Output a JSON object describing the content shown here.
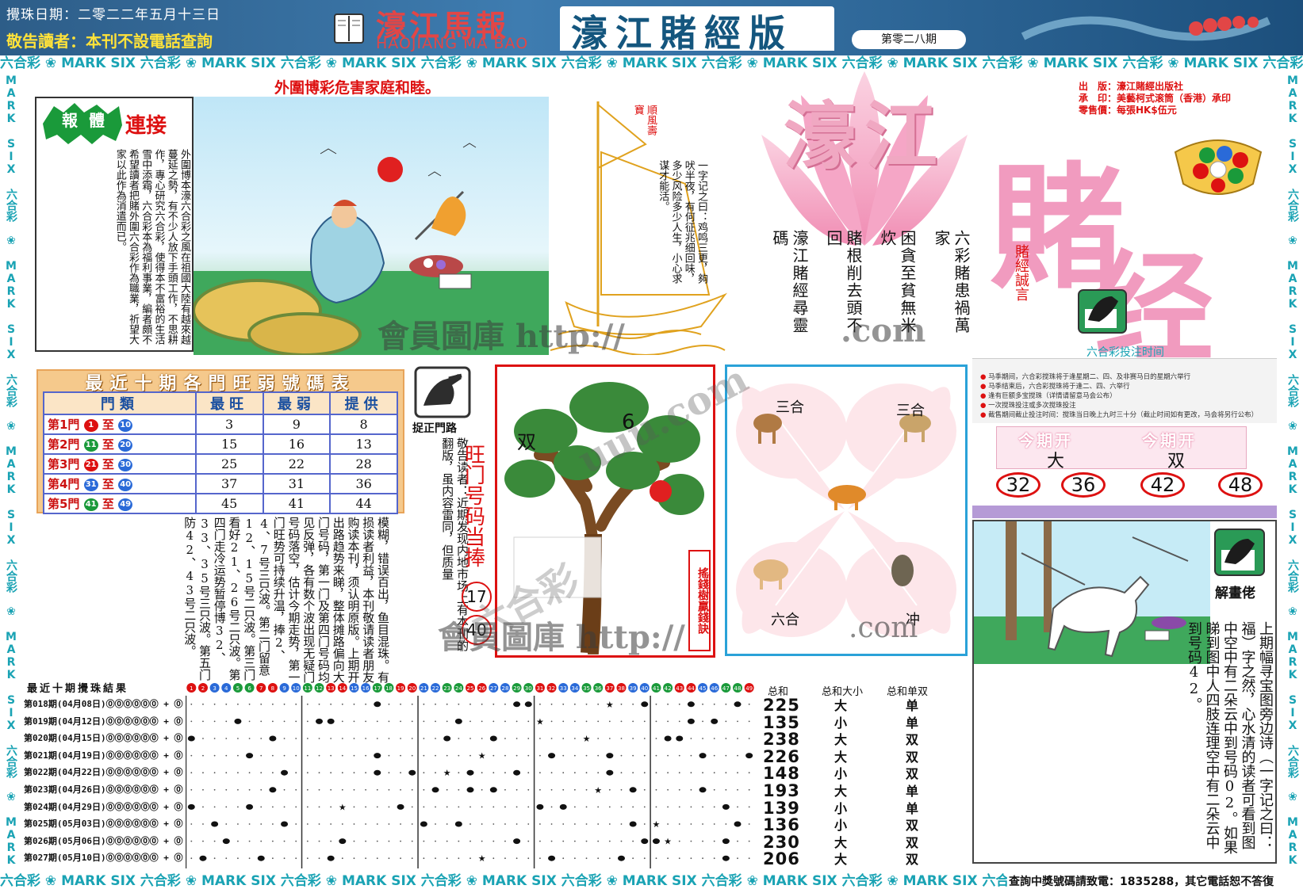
{
  "header": {
    "date": "攪珠日期：二零二二年五月十三日",
    "notice": "敬告讀者：本刊不設電話查詢",
    "paper_name": "濠江馬報",
    "paper_roman": "HAOJIANG MA BAO",
    "edition": "濠江賭經版",
    "issue": "第零二八期"
  },
  "border": {
    "text": "六合彩 ❀ MARK SIX 六合彩 ❀ MARK SIX 六合彩 ❀ MARK SIX 六合彩 ❀ MARK SIX 六合彩 ❀ MARK SIX 六合彩 ❀ MARK SIX 六合彩 ❀ MARK SIX 六合彩 ❀ MARK SIX 六合彩 ❀ MARK SIX 六合彩 ❀ MARK SIX",
    "side_text": "MARK SIX 六合彩 ❀ MARK SIX 六合彩 ❀ MARK SIX 六合彩 ❀ MARK SIX 六合彩 ❀ MARK SIX 六合彩 ❀ MARK SIX 六合彩 ❀ MARK SIX 六合彩 ❀"
  },
  "footer": {
    "contact": "查詢中獎號碼請致電：1835288，其它電話恕不答復"
  },
  "article": {
    "slogan": "外圍博彩危害家庭和睦。",
    "badge_a": "報",
    "badge_b": "體",
    "badge_c": "連接",
    "body": "外圍博本濠六合彩之風在祖國大陸有越來越蔓延之勢，有不少人放下手頭工作，不思耕作，專心研究六合彩，使得本不富裕的生活雪中添霜，六合彩本為福利事業，編者頗不希望讀者把賭外圍六合彩作為職業，祈望大家以此作為消遣而已。"
  },
  "table": {
    "title": "最近十期各門旺弱號碼表",
    "headers": [
      "門類",
      "最旺",
      "最弱",
      "提供"
    ],
    "rows": [
      {
        "gate": "第1門",
        "from": "1",
        "to": "10",
        "strong": "3",
        "weak": "9",
        "provide": "8"
      },
      {
        "gate": "第2門",
        "from": "11",
        "to": "20",
        "strong": "15",
        "weak": "16",
        "provide": "13"
      },
      {
        "gate": "第3門",
        "from": "21",
        "to": "30",
        "strong": "25",
        "weak": "22",
        "provide": "28"
      },
      {
        "gate": "第4門",
        "from": "31",
        "to": "40",
        "strong": "37",
        "weak": "31",
        "provide": "36"
      },
      {
        "gate": "第5門",
        "from": "41",
        "to": "49",
        "strong": "45",
        "weak": "41",
        "provide": "44"
      }
    ],
    "range_word": "至",
    "colors": {
      "1": "#d11",
      "11": "#1a9a3a",
      "21": "#d11",
      "31": "#2a6ad8",
      "41": "#1a9a3a"
    }
  },
  "gate_text": "模糊，错误百出，鱼目混珠。有损读者利益，本刊敬请读者朋友购读本刊，须认明原版。上期开出路趋势来睇，整体摊路偏向大门号码，第一门及第四门号码均见反弹，各有数个波出现无疑门号码落空，估计今期走势，第一门旺势可持续升温，捧2、4、7号三只波。第二门留意12、15号二只波。第三门看好21、26号二只波。第四门走冷运势暂停博32、33、35号三只波。第五门防42、43号二只波。",
  "gate_icon_label": "捉正門路",
  "gate_notice": "敬告读者：近期发现内地市场上有本刊的翻版，虽内容雷同，但质量",
  "wangmen": {
    "label": "旺门号码当捧",
    "numbers": [
      "17",
      "40"
    ]
  },
  "tree": {
    "left_label": "双",
    "top_label": "6",
    "side_label": "搖錢樹贏錢訣"
  },
  "zodiac": {
    "top_left": "三合",
    "top_right": "三合",
    "bottom_left": "六合",
    "bottom_right": "冲",
    "suffix": ".com"
  },
  "boat": {
    "flag": "順風壽寶",
    "text": "一字记之曰：鸡鸣三更，夠吠半夜，有何征兆细回味，多少风险多少人生，小心求谋才能活。"
  },
  "poem": {
    "cols": [
      "六彩賭患禍萬家",
      "困貪至貧無米炊",
      "賭根削去頭不回",
      "濠江賭經尋靈碼"
    ]
  },
  "logo": {
    "part_a": "濠江",
    "part_b": "賭",
    "part_c": "经",
    "maxim": "賭經誠言"
  },
  "publisher": {
    "line1": "出　版：濠江賭經出版社",
    "line2": "承　印：美藝柯式滚筒（香港）承印",
    "line3": "零售價：每張HK$伍元"
  },
  "schedule": {
    "title": "六合彩投注时间",
    "lines": [
      "马季期间，六合彩搅珠将于逢星期二、四、及非赛马日的星期六举行",
      "马季结束后，六合彩搅珠将于逢二、四、六举行",
      "逢有巨额多宝搅珠（详情请留意马会公布）",
      "一次搅珠投注或多次搅珠投注",
      "截售期间截止投注时间：搅珠当日晚上九时三十分（截止时间如有更改，马会将另行公布）"
    ]
  },
  "picks": {
    "header": "今期开",
    "values": [
      "大",
      "双"
    ],
    "numbers": [
      "32",
      "36",
      "42",
      "48"
    ]
  },
  "riddle": {
    "label": "解畫佬",
    "text": "上期幅寻宝图旁边诗（一字记之曰：福）字之然，心水清的读者可看到图中空中有二朵云中到号码02。如果睇到图中人四肢连理空中有二朵云中到号码42。"
  },
  "results": {
    "title": "最近十期攪珠結果",
    "headers": {
      "sum": "总和",
      "big_small": "总和大小",
      "odd_even": "总和单双"
    },
    "rows": [
      {
        "issue": "第018期",
        "date": "(04月08日)",
        "codes": "⓪⓪⓪⓪⓪⓪ + ⓪",
        "sum": "225",
        "bs": "大",
        "oe": "单"
      },
      {
        "issue": "第019期",
        "date": "(04月12日)",
        "codes": "⓪⓪⓪⓪⓪⓪ + ⓪",
        "sum": "135",
        "bs": "小",
        "oe": "单"
      },
      {
        "issue": "第020期",
        "date": "(04月15日)",
        "codes": "⓪⓪⓪⓪⓪⓪ + ⓪",
        "sum": "238",
        "bs": "大",
        "oe": "双"
      },
      {
        "issue": "第021期",
        "date": "(04月19日)",
        "codes": "⓪⓪⓪⓪⓪⓪ + ⓪",
        "sum": "226",
        "bs": "大",
        "oe": "双"
      },
      {
        "issue": "第022期",
        "date": "(04月22日)",
        "codes": "⓪⓪⓪⓪⓪⓪ + ⓪",
        "sum": "148",
        "bs": "小",
        "oe": "双"
      },
      {
        "issue": "第023期",
        "date": "(04月26日)",
        "codes": "⓪⓪⓪⓪⓪⓪ + ⓪",
        "sum": "193",
        "bs": "大",
        "oe": "单"
      },
      {
        "issue": "第024期",
        "date": "(04月29日)",
        "codes": "⓪⓪⓪⓪⓪⓪ + ⓪",
        "sum": "139",
        "bs": "小",
        "oe": "单"
      },
      {
        "issue": "第025期",
        "date": "(05月03日)",
        "codes": "⓪⓪⓪⓪⓪⓪ + ⓪",
        "sum": "136",
        "bs": "小",
        "oe": "双"
      },
      {
        "issue": "第026期",
        "date": "(05月06日)",
        "codes": "⓪⓪⓪⓪⓪⓪ + ⓪",
        "sum": "230",
        "bs": "大",
        "oe": "双"
      },
      {
        "issue": "第027期",
        "date": "(05月10日)",
        "codes": "⓪⓪⓪⓪⓪⓪ + ⓪",
        "sum": "206",
        "bs": "大",
        "oe": "双"
      }
    ],
    "draws": [
      [
        17,
        30,
        29,
        40,
        44,
        48,
        37
      ],
      [
        12,
        13,
        5,
        24,
        44,
        46,
        31
      ],
      [
        1,
        8,
        23,
        27,
        42,
        43,
        35
      ],
      [
        6,
        17,
        32,
        37,
        49,
        45,
        26
      ],
      [
        9,
        17,
        20,
        25,
        29,
        37,
        23
      ],
      [
        8,
        22,
        25,
        27,
        39,
        45,
        36
      ],
      [
        1,
        6,
        19,
        31,
        33,
        47,
        14
      ],
      [
        3,
        9,
        21,
        24,
        39,
        48,
        41
      ],
      [
        4,
        14,
        29,
        40,
        41,
        47,
        42
      ],
      [
        2,
        7,
        13,
        32,
        38,
        47,
        26
      ]
    ]
  },
  "watermark": {
    "a": "會員圖庫 http://",
    "b": ".com",
    "c": "會員圖庫 http://",
    "d": "uuu.com",
    "e": "六合彩"
  },
  "colors": {
    "red": "#d11",
    "teal": "#1aa3b4",
    "pink": "#f19bbf",
    "blue_frame": "#2aa2d8"
  }
}
